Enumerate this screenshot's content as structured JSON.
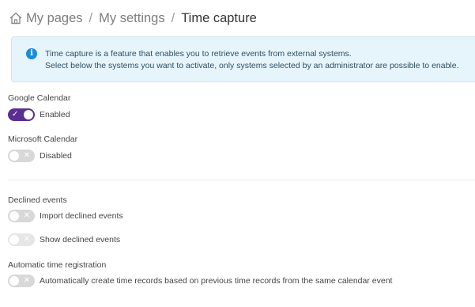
{
  "breadcrumb": {
    "home_icon": "home-icon",
    "items": [
      "My pages",
      "My settings"
    ],
    "separator": "/",
    "current": "Time capture"
  },
  "info": {
    "icon": "info-icon",
    "glyph": "i",
    "line1": "Time capture is a feature that enables you to retrieve events from external systems.",
    "line2": "Select below the systems you want to activate, only systems selected by an administrator are possible to enable."
  },
  "google": {
    "label": "Google Calendar",
    "status": "Enabled",
    "on": true
  },
  "microsoft": {
    "label": "Microsoft Calendar",
    "status": "Disabled",
    "on": false
  },
  "declined": {
    "label": "Declined events",
    "import_label": "Import declined events",
    "show_label": "Show declined events"
  },
  "auto": {
    "label": "Automatic time registration",
    "toggle_label": "Automatically create time records based on previous time records from the same calendar event"
  },
  "symbols": {
    "check": "✓",
    "cross": "✕"
  },
  "colors": {
    "accent": "#5c2e91",
    "info_bg": "#e6f4fc",
    "info_icon": "#1a8cd8",
    "toggle_off": "#d8d8d8"
  }
}
